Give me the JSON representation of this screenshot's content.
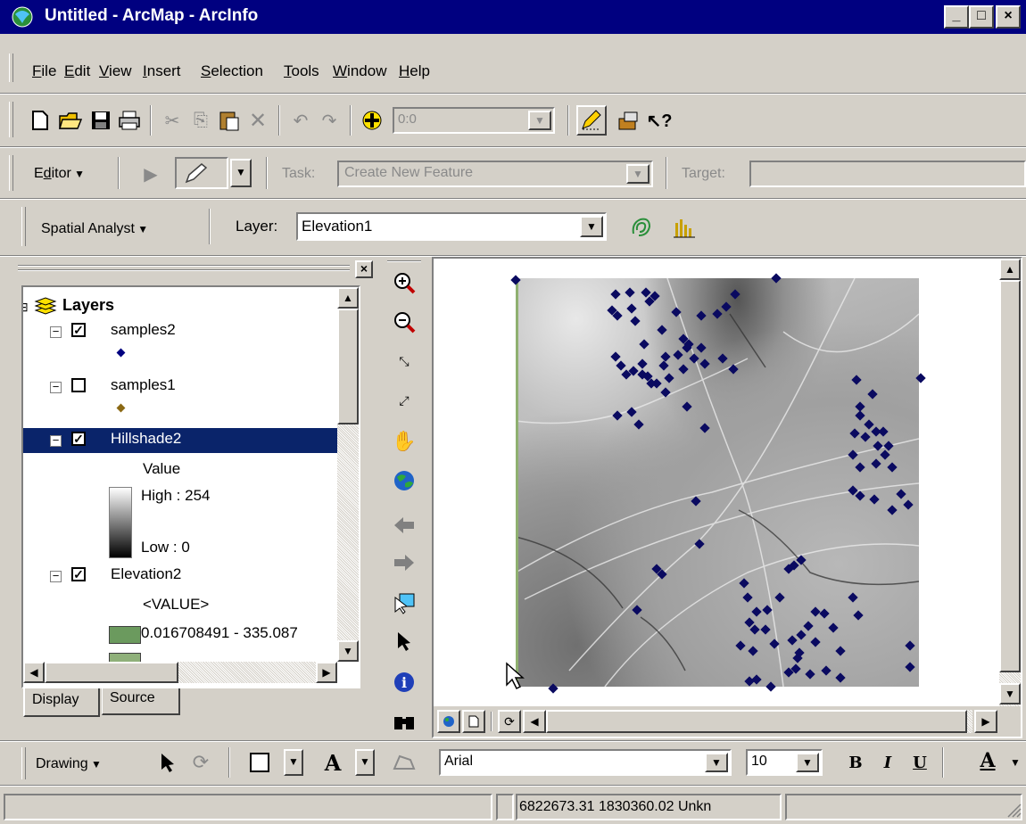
{
  "window": {
    "title": "Untitled - ArcMap - ArcInfo",
    "controls": [
      "_",
      "□",
      "×"
    ]
  },
  "menu": [
    {
      "key": "F",
      "rest": "ile"
    },
    {
      "key": "E",
      "rest": "dit"
    },
    {
      "key": "V",
      "rest": "iew"
    },
    {
      "key": "I",
      "rest": "nsert"
    },
    {
      "key": "S",
      "rest": "election"
    },
    {
      "key": "T",
      "rest": "ools"
    },
    {
      "key": "W",
      "rest": "indow"
    },
    {
      "key": "H",
      "rest": "elp"
    }
  ],
  "standard_toolbar": {
    "scale_value": "0:0"
  },
  "editor_toolbar": {
    "editor_label": "Editor",
    "editor_key": "d",
    "task_label": "Task:",
    "task_value": "Create New Feature",
    "target_label": "Target:",
    "target_value": ""
  },
  "spatial_toolbar": {
    "label": "Spatial Analyst",
    "layer_label": "Layer:",
    "layer_value": "Elevation1"
  },
  "toc": {
    "root": "Layers",
    "layers": [
      {
        "name": "samples2",
        "checked": true,
        "symbol_color": "#000080"
      },
      {
        "name": "samples1",
        "checked": false,
        "symbol_color": "#8b6914"
      },
      {
        "name": "Hillshade2",
        "checked": true,
        "selected": true,
        "legend_title": "Value",
        "high": "High : 254",
        "low": "Low : 0"
      },
      {
        "name": "Elevation2",
        "checked": true,
        "legend_title": "<VALUE>",
        "class1": "0.016708491 - 335.087",
        "class1_color": "#6b9a5e"
      }
    ],
    "tabs": {
      "display": "Display",
      "source": "Source"
    }
  },
  "drawing_toolbar": {
    "label": "Drawing",
    "font": "Arial",
    "size": "10",
    "bold": "B",
    "italic": "I",
    "underline": "U",
    "font_color_glyph": "A"
  },
  "status": {
    "coords": "6822673.31  1830360.02 Unkn"
  },
  "map": {
    "point_color": "#0a0a60"
  }
}
